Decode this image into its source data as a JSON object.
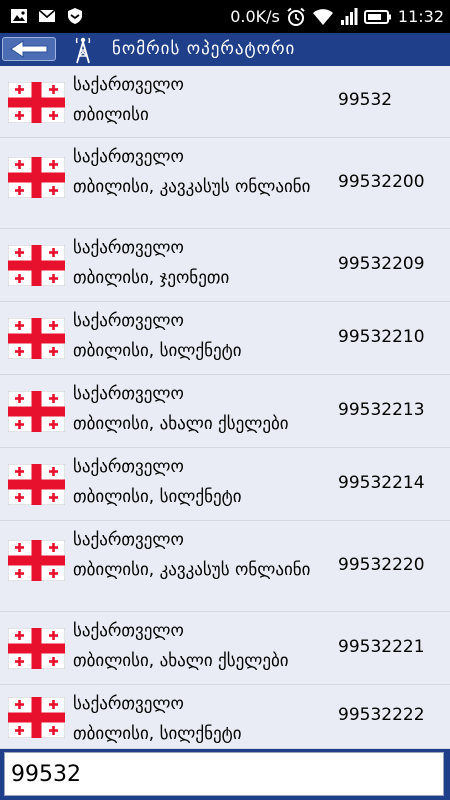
{
  "status_bar": {
    "speed": "0.0K/s",
    "time": "11:32"
  },
  "title_bar": {
    "title": "ნომრის ოპერატორი"
  },
  "results": [
    {
      "country": "საქართველო",
      "city": "თბილისი",
      "code": "99532"
    },
    {
      "country": "საქართველო",
      "city": "თბილისი, კავკასუს ონლაინი",
      "code": "99532200"
    },
    {
      "country": "საქართველო",
      "city": "თბილისი, ჯეონეთი",
      "code": "99532209"
    },
    {
      "country": "საქართველო",
      "city": "თბილისი, სილქნეტი",
      "code": "99532210"
    },
    {
      "country": "საქართველო",
      "city": "თბილისი, ახალი ქსელები",
      "code": "99532213"
    },
    {
      "country": "საქართველო",
      "city": "თბილისი, სილქნეტი",
      "code": "99532214"
    },
    {
      "country": "საქართველო",
      "city": "თბილისი, კავკასუს ონლაინი",
      "code": "99532220"
    },
    {
      "country": "საქართველო",
      "city": "თბილისი, ახალი ქსელები",
      "code": "99532221"
    },
    {
      "country": "საქართველო",
      "city": "თბილისი, სილქნეტი",
      "code": "99532222"
    }
  ],
  "search": {
    "value": "99532"
  },
  "colors": {
    "title_bar": "#1f3f8a",
    "list_background": "#e9ecf4",
    "flag_red": "#e8112d"
  }
}
